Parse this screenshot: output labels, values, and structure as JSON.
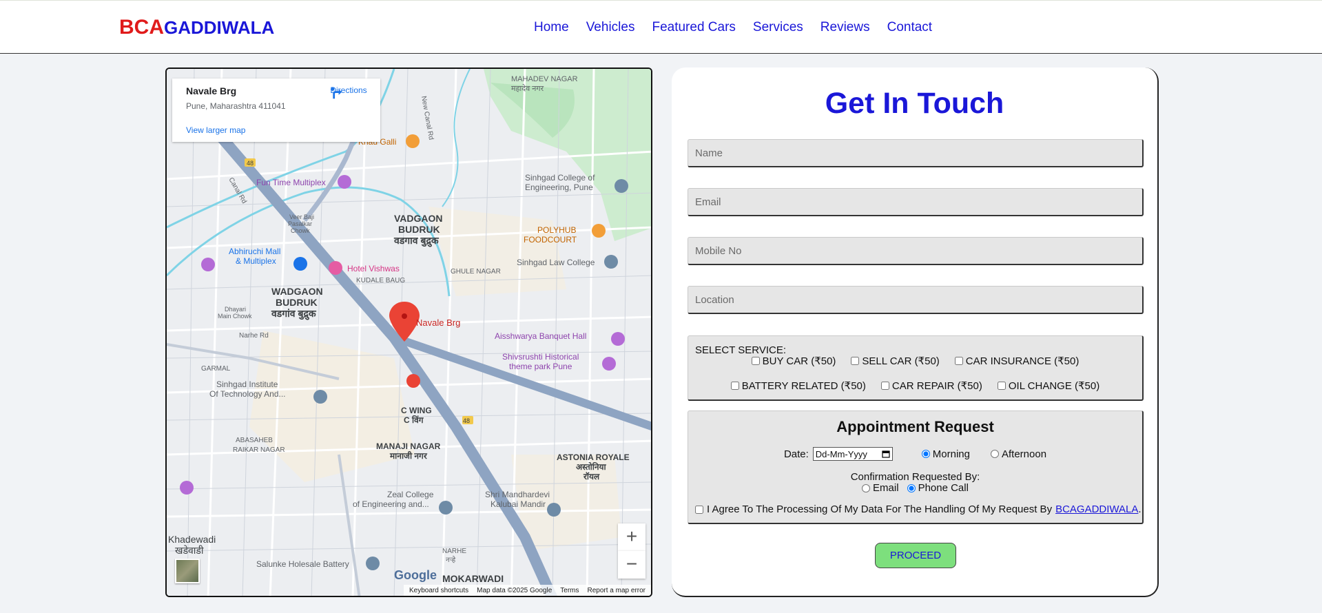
{
  "brand": {
    "part1": "BCA",
    "part2": "GADDIWALA"
  },
  "nav": [
    "Home",
    "Vehicles",
    "Featured Cars",
    "Services",
    "Reviews",
    "Contact"
  ],
  "map": {
    "place_name": "Navale Brg",
    "address": "Pune, Maharashtra 411041",
    "directions": "Directions",
    "view_larger": "View larger map",
    "marker_label": "Navale Brg",
    "zoom_in": "+",
    "zoom_out": "−",
    "google": "Google",
    "footer": [
      "Keyboard shortcuts",
      "Map data ©2025 Google",
      "Terms",
      "Report a map error"
    ],
    "labels": [
      {
        "text": "MAHADEV NAGAR",
        "color": "#5f6368"
      },
      {
        "text": "महादेव नगर",
        "color": "#5f6368"
      },
      {
        "text": "Khau Galli",
        "color": "#c26400"
      },
      {
        "text": "Fun Time Multiplex",
        "color": "#8e44ad"
      },
      {
        "text": "Sinhgad College of",
        "color": "#5f6368"
      },
      {
        "text": "Engineering, Pune",
        "color": "#5f6368"
      },
      {
        "text": "VADGAON",
        "color": "#3c4043"
      },
      {
        "text": "BUDRUK",
        "color": "#3c4043"
      },
      {
        "text": "वडगाव बुद्रुक",
        "color": "#3c4043"
      },
      {
        "text": "POLYHUB",
        "color": "#c26400"
      },
      {
        "text": "FOODCOURT",
        "color": "#c26400"
      },
      {
        "text": "Sinhgad Law College",
        "color": "#5f6368"
      },
      {
        "text": "Abhiruchi Mall",
        "color": "#1a73e8"
      },
      {
        "text": "& Multiplex",
        "color": "#1a73e8"
      },
      {
        "text": "Hotel Vishwas",
        "color": "#d63384"
      },
      {
        "text": "KUDALE BAUG",
        "color": "#5f6368"
      },
      {
        "text": "GHULE NAGAR",
        "color": "#5f6368"
      },
      {
        "text": "WADGAON",
        "color": "#3c4043"
      },
      {
        "text": "BUDRUK",
        "color": "#3c4043"
      },
      {
        "text": "वडगांव बुद्रुक",
        "color": "#3c4043"
      },
      {
        "text": "Aisshwarya Banquet Hall",
        "color": "#8e44ad"
      },
      {
        "text": "Shivsrushti Historical",
        "color": "#8e44ad"
      },
      {
        "text": "theme park Pune",
        "color": "#8e44ad"
      },
      {
        "text": "GARMAL",
        "color": "#5f6368"
      },
      {
        "text": "Sinhgad Institute",
        "color": "#5f6368"
      },
      {
        "text": "Of Technology And...",
        "color": "#5f6368"
      },
      {
        "text": "C WING",
        "color": "#3c4043"
      },
      {
        "text": "C विंग",
        "color": "#3c4043"
      },
      {
        "text": "ABASAHEB",
        "color": "#5f6368"
      },
      {
        "text": "RAIKAR NAGAR",
        "color": "#5f6368"
      },
      {
        "text": "MANAJI NAGAR",
        "color": "#3c4043"
      },
      {
        "text": "मानाजी नगर",
        "color": "#3c4043"
      },
      {
        "text": "ASTONIA ROYALE",
        "color": "#3c4043"
      },
      {
        "text": "अस्तोनिया",
        "color": "#3c4043"
      },
      {
        "text": "रॉयल",
        "color": "#3c4043"
      },
      {
        "text": "Zeal College",
        "color": "#5f6368"
      },
      {
        "text": "of Engineering and...",
        "color": "#5f6368"
      },
      {
        "text": "Shri Mandhardevi",
        "color": "#5f6368"
      },
      {
        "text": "Kalubai Mandir",
        "color": "#5f6368"
      },
      {
        "text": "Khadewadi",
        "color": "#3c4043"
      },
      {
        "text": "खडेवाडी",
        "color": "#3c4043"
      },
      {
        "text": "Salunke Holesale Battery",
        "color": "#5f6368"
      },
      {
        "text": "MOKARWADI",
        "color": "#3c4043"
      },
      {
        "text": "NARHE",
        "color": "#5f6368"
      },
      {
        "text": "नऱ्हे",
        "color": "#5f6368"
      },
      {
        "text": "Narhe Rd",
        "color": "#5f6368"
      },
      {
        "text": "Canal Rd",
        "color": "#5f6368"
      },
      {
        "text": "New Canal Rd",
        "color": "#5f6368"
      },
      {
        "text": "Veer Baji",
        "color": "#5f6368"
      },
      {
        "text": "Pasalkar",
        "color": "#5f6368"
      },
      {
        "text": "Chowk",
        "color": "#5f6368"
      },
      {
        "text": "Dhayari",
        "color": "#5f6368"
      },
      {
        "text": "Main Chowk",
        "color": "#5f6368"
      },
      {
        "text": "48",
        "color": "#3c4043"
      }
    ]
  },
  "contact": {
    "heading": "Get In Touch",
    "fields": {
      "name": "Name",
      "email": "Email",
      "mobile": "Mobile No",
      "location": "Location"
    },
    "service": {
      "title": "SELECT SERVICE:",
      "row1": [
        "BUY CAR (₹50)",
        "SELL CAR (₹50)",
        "CAR INSURANCE (₹50)"
      ],
      "row2": [
        "BATTERY RELATED (₹50)",
        "CAR REPAIR (₹50)",
        "OIL CHANGE (₹50)"
      ]
    },
    "appointment": {
      "title": "Appointment Request",
      "date_label": "Date:",
      "date_placeholder": "Dd-Mm-Yyyy",
      "time_options": [
        "Morning",
        "Afternoon"
      ],
      "time_selected": "Morning",
      "confirm_label": "Confirmation Requested By:",
      "confirm_options": [
        "Email",
        "Phone Call"
      ],
      "confirm_selected": "Phone Call",
      "agree_text": "I Agree To The Processing Of My Data For The Handling Of My Request By",
      "agree_link": "BCAGADDIWALA",
      "agree_end": "."
    },
    "submit": "PROCEED"
  },
  "colors": {
    "brand_red": "#e01b1b",
    "brand_blue": "#1a17d8",
    "button_green": "#7ddf7d"
  }
}
